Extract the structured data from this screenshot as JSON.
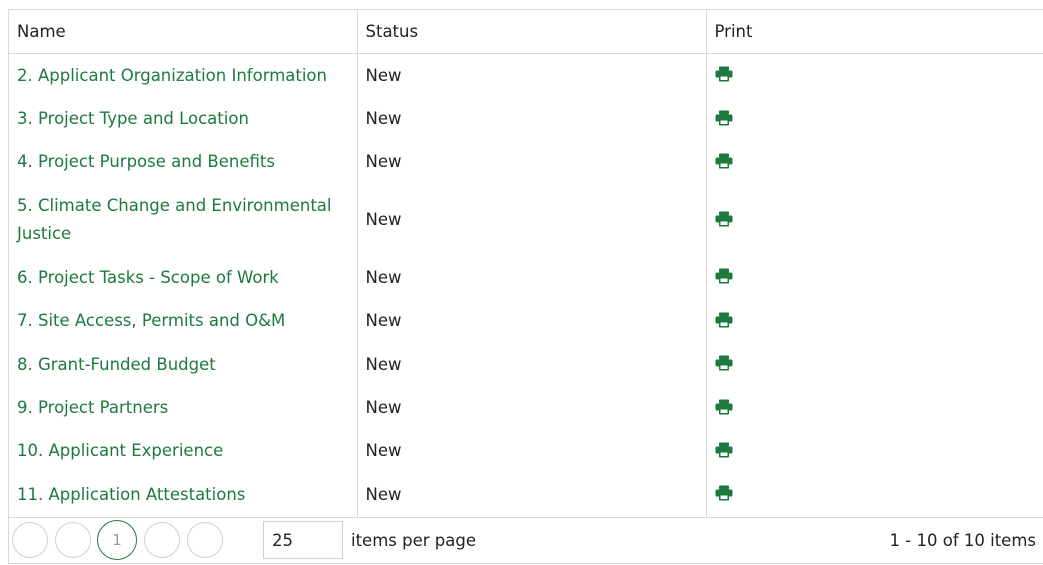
{
  "columns": {
    "name": "Name",
    "status": "Status",
    "print": "Print"
  },
  "rows": [
    {
      "name": "2. Applicant Organization Information",
      "status": "New"
    },
    {
      "name": "3. Project Type and Location",
      "status": "New"
    },
    {
      "name": "4. Project Purpose and Benefits",
      "status": "New"
    },
    {
      "name": "5. Climate Change and Environmental Justice",
      "status": "New"
    },
    {
      "name": "6. Project Tasks - Scope of Work",
      "status": "New"
    },
    {
      "name": "7. Site Access, Permits and O&M",
      "status": "New"
    },
    {
      "name": "8. Grant-Funded Budget",
      "status": "New"
    },
    {
      "name": "9. Project Partners",
      "status": "New"
    },
    {
      "name": "10. Applicant Experience",
      "status": "New"
    },
    {
      "name": "11. Application Attestations",
      "status": "New"
    }
  ],
  "icons": {
    "print": "print-icon"
  },
  "colors": {
    "link": "#1c7a3e",
    "accent": "#1c7a3e"
  },
  "pager": {
    "current_page": "1",
    "page_size": "25",
    "items_per_page_label": "items per page",
    "info": "1 - 10 of 10 items"
  }
}
